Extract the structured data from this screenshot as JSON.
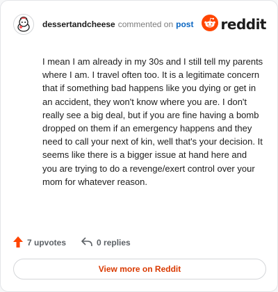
{
  "header": {
    "username": "dessertandcheese",
    "action": "commented on",
    "post_link": "post",
    "brand": "reddit",
    "avatar_icon": "snoo-avatar-icon",
    "logo_icon": "reddit-snoo-icon"
  },
  "comment": {
    "text": "I mean I am already in my 30s and I still tell my parents where I am. I travel often too. It is a legitimate concern that if something bad happens like you dying or get in an accident, they won't know where you are. I don't really see a big deal, but if you are fine having a bomb dropped on them if an emergency happens and they need to call your next of kin, well that's your decision. It seems like there is a bigger issue at hand here and you are trying to do a revenge/exert control over your mom for whatever reason."
  },
  "actions": {
    "upvotes_label": "7 upvotes",
    "replies_label": "0 replies",
    "upvote_icon": "upvote-arrow-icon",
    "reply_icon": "reply-arrow-icon"
  },
  "footer": {
    "view_more_label": "View more on Reddit"
  },
  "colors": {
    "brand_orange": "#ff4500",
    "link_blue": "#0a66c2",
    "cta_text": "#d93900"
  }
}
